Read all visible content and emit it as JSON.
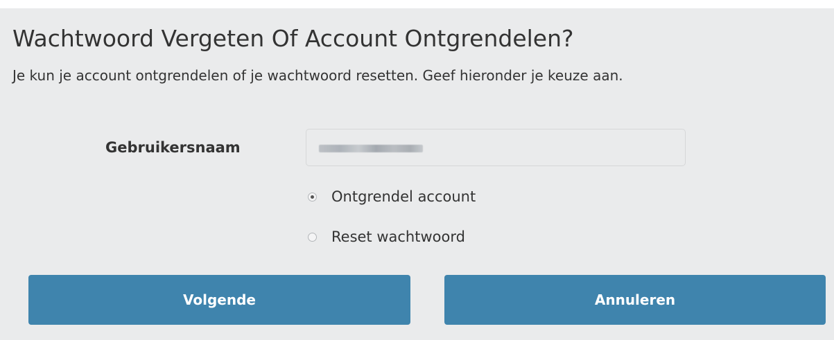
{
  "form": {
    "title": "Wachtwoord Vergeten Of Account Ontgrendelen?",
    "intro": "Je kun je account ontgrendelen of je wachtwoord resetten. Geef hieronder je keuze aan.",
    "username_label": "Gebruikersnaam",
    "username_value_note": "blurred",
    "options": [
      {
        "label": "Ontgrendel account",
        "checked": true
      },
      {
        "label": "Reset wachtwoord",
        "checked": false
      }
    ],
    "next_label": "Volgende",
    "cancel_label": "Annuleren"
  },
  "colors": {
    "panel_background": "#eaebec",
    "button_background": "#3f84ad",
    "button_text": "#ffffff",
    "text": "#333333"
  }
}
